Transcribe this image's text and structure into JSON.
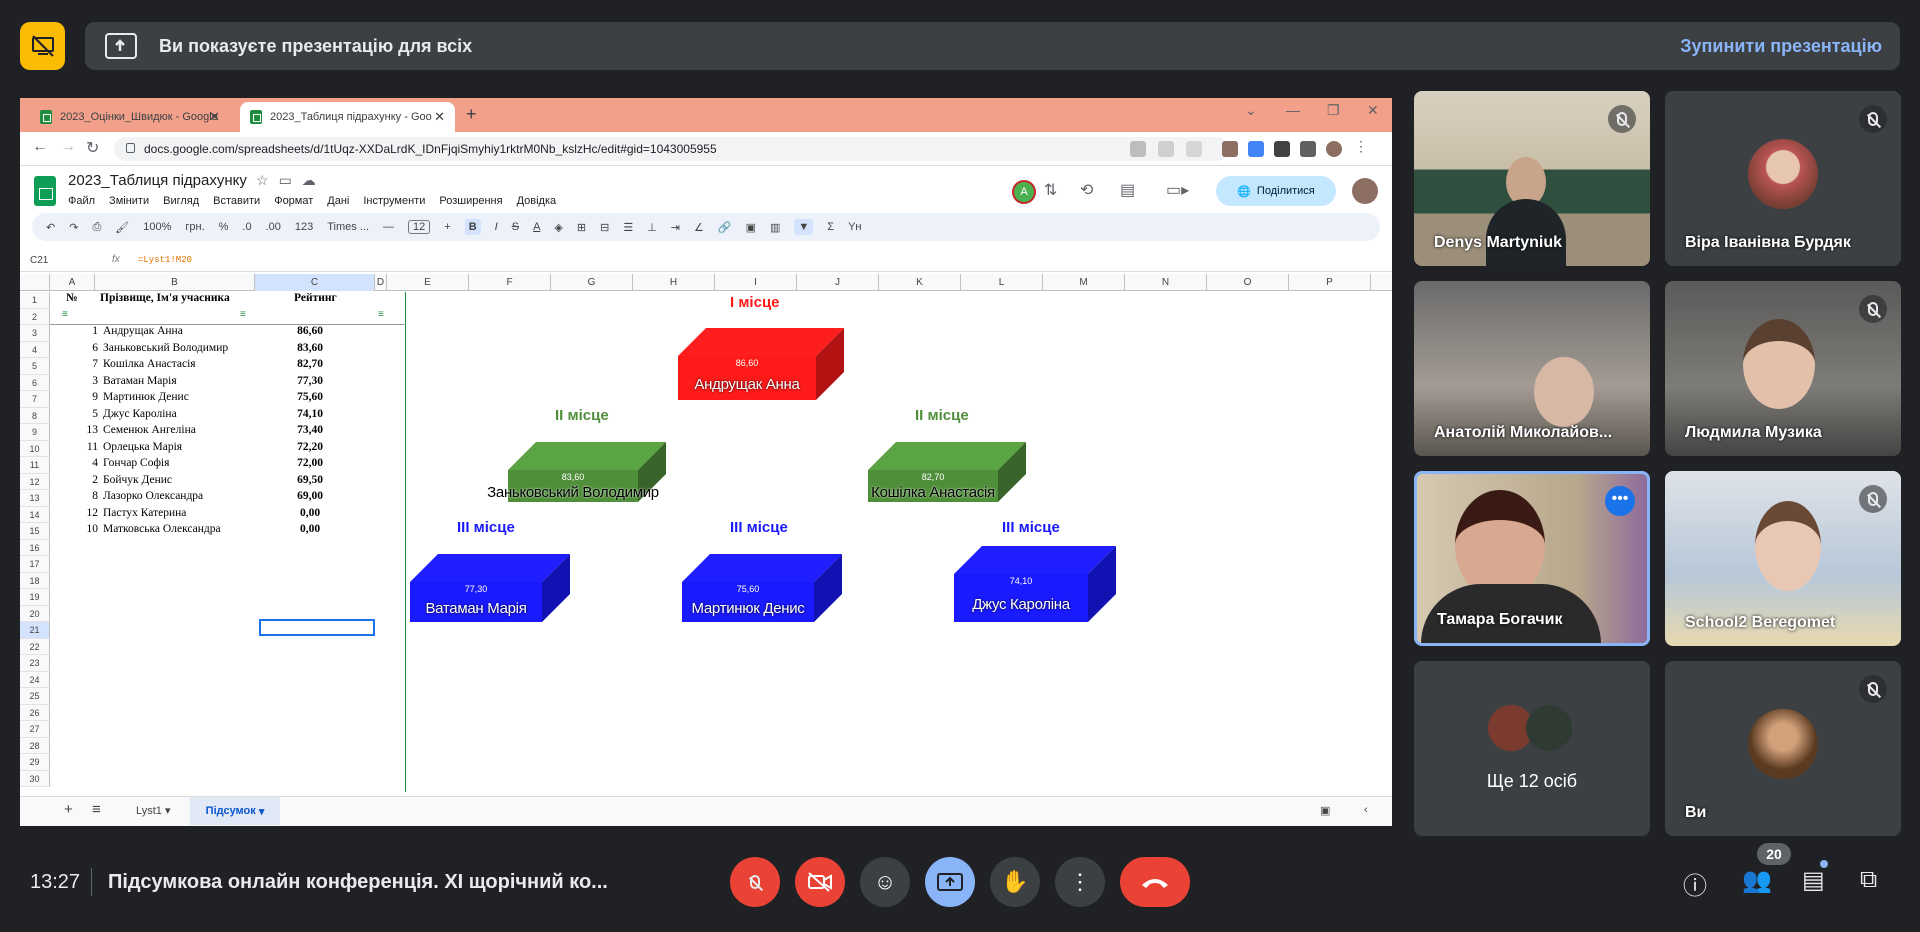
{
  "banner": {
    "message": "Ви показуєте презентацію для всіх",
    "stop_label": "Зупинити презентацію",
    "present_icon": "screen-share-off-icon"
  },
  "browser": {
    "tabs": [
      {
        "label": "2023_Оцінки_Швидюк - Google"
      },
      {
        "label": "2023_Таблиця підрахунку - Goo"
      }
    ],
    "url": "docs.google.com/spreadsheets/d/1tUqz-XXDaLrdK_IDnFjqiSmyhiy1rktrM0Nb_kslzHc/edit#gid=1043005955"
  },
  "sheet": {
    "title": "2023_Таблиця підрахунку",
    "menus": [
      "Файл",
      "Змінити",
      "Вигляд",
      "Вставити",
      "Формат",
      "Дані",
      "Інструменти",
      "Розширення",
      "Довідка"
    ],
    "share_label": "Поділитися",
    "avatar_letter": "A",
    "toolbar": {
      "zoom": "100%",
      "currency": "грн.",
      "percent": "%",
      "dec_dec": ".0",
      "dec_inc": ".00",
      "num": "123",
      "font": "Times ...",
      "font_size": "12",
      "bold": "B",
      "italic": "I",
      "strike": "S",
      "textcolor": "A",
      "sum": "Σ",
      "lang": "Yʜ"
    },
    "cell_ref": "C21",
    "formula": "=Lyst1!M20",
    "columns": [
      "A",
      "B",
      "C",
      "D",
      "E",
      "F",
      "G",
      "H",
      "I",
      "J",
      "K",
      "L",
      "M",
      "N",
      "O",
      "P"
    ],
    "rows": [
      "1",
      "2",
      "3",
      "4",
      "5",
      "6",
      "7",
      "8",
      "9",
      "10",
      "11",
      "12",
      "13",
      "14",
      "15",
      "16",
      "17",
      "18",
      "19",
      "20",
      "21",
      "22",
      "23",
      "24",
      "25",
      "26",
      "27",
      "28",
      "29",
      "30"
    ],
    "header": {
      "num": "№",
      "name": "Прізвище, Ім'я учасника",
      "score": "Рейтинг"
    },
    "data": [
      {
        "num": "1",
        "name": "Андрущак Анна",
        "score": "86,60"
      },
      {
        "num": "6",
        "name": "Заньковський Володимир",
        "score": "83,60"
      },
      {
        "num": "7",
        "name": "Кошілка Анастасія",
        "score": "82,70"
      },
      {
        "num": "3",
        "name": "Ватаман Марія",
        "score": "77,30"
      },
      {
        "num": "9",
        "name": "Мартинюк Денис",
        "score": "75,60"
      },
      {
        "num": "5",
        "name": "Джус Кароліна",
        "score": "74,10"
      },
      {
        "num": "13",
        "name": "Семенюк Ангеліна",
        "score": "73,40"
      },
      {
        "num": "11",
        "name": "Орлецька Марія",
        "score": "72,20"
      },
      {
        "num": "4",
        "name": "Гончар Софія",
        "score": "72,00"
      },
      {
        "num": "2",
        "name": "Бойчук Денис",
        "score": "69,50"
      },
      {
        "num": "8",
        "name": "Лазорко Олександра",
        "score": "69,00"
      },
      {
        "num": "12",
        "name": "Пастух Катерина",
        "score": "0,00"
      },
      {
        "num": "10",
        "name": "Матковська Олександра",
        "score": "0,00"
      }
    ],
    "sheet_tabs": [
      "Lyst1",
      "Підсумок"
    ]
  },
  "podium": {
    "places": {
      "first": "І місце",
      "second": "ІІ місце",
      "third": "ІІІ місце"
    },
    "colors": {
      "first": "#ff1a1a",
      "second": "#4f8f3a",
      "third": "#1a1aff"
    },
    "blocks": [
      {
        "place": "first",
        "name": "Андрущак Анна",
        "value": "86,60"
      },
      {
        "place": "second",
        "name": "Заньковський Володимир",
        "value": "83,60"
      },
      {
        "place": "second",
        "name": "Кошілка Анастасія",
        "value": "82,70"
      },
      {
        "place": "third",
        "name": "Ватаман Марія",
        "value": "77,30"
      },
      {
        "place": "third",
        "name": "Мартинюк Денис",
        "value": "75,60"
      },
      {
        "place": "third",
        "name": "Джус Кароліна",
        "value": "74,10"
      }
    ]
  },
  "participants": [
    {
      "name": "Denys Martyniuk",
      "muted": true
    },
    {
      "name": "Віра Іванівна Бурдяк",
      "muted": true
    },
    {
      "name": "Анатолій Миколайов...",
      "muted": false
    },
    {
      "name": "Людмила Музика",
      "muted": true
    },
    {
      "name": "Тамара Богачик",
      "muted": false
    },
    {
      "name": "School2 Beregomet",
      "muted": true
    },
    {
      "name": "Ще 12 осіб",
      "muted": false
    },
    {
      "name": "Ви",
      "muted": true
    }
  ],
  "bottom": {
    "time": "13:27",
    "meeting_title": "Підсумкова онлайн конференція. ХІ щорічний ко...",
    "people_count": "20"
  }
}
